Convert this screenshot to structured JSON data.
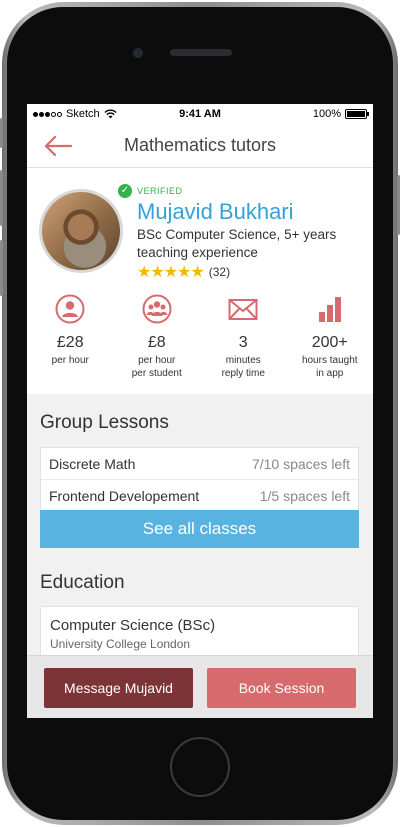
{
  "status_bar": {
    "carrier": "Sketch",
    "time": "9:41 AM",
    "battery": "100%"
  },
  "nav": {
    "title": "Mathematics tutors",
    "back_icon": "arrow-left-icon"
  },
  "tutor": {
    "verified_label": "VERIFIED",
    "name": "Mujavid Bukhari",
    "description": "BSc Computer Science, 5+ years teaching experience",
    "stars": "★★★★★",
    "rating_value": 5,
    "review_count": "(32)"
  },
  "stats": [
    {
      "icon": "user-icon",
      "value": "£28",
      "label_line1": "per hour",
      "label_line2": ""
    },
    {
      "icon": "group-icon",
      "value": "£8",
      "label_line1": "per hour",
      "label_line2": "per student"
    },
    {
      "icon": "envelope-icon",
      "value": "3",
      "label_line1": "minutes",
      "label_line2": "reply time"
    },
    {
      "icon": "bar-chart-icon",
      "value": "200+",
      "label_line1": "hours taught",
      "label_line2": "in app"
    }
  ],
  "group_lessons": {
    "title": "Group Lessons",
    "items": [
      {
        "name": "Discrete Math",
        "spaces": "7/10 spaces left"
      },
      {
        "name": "Frontend Developement",
        "spaces": "1/5 spaces left"
      }
    ],
    "see_all_label": "See all classes"
  },
  "education": {
    "title": "Education",
    "degree": "Computer Science (BSc)",
    "school": "University College London"
  },
  "actions": {
    "message_label": "Message Mujavid",
    "book_label": "Book Session"
  },
  "colors": {
    "accent_red": "#d66a6c",
    "dark_red": "#7c3436",
    "link_blue": "#37a0d9",
    "button_blue": "#59b3e0",
    "verified_green": "#35b24a",
    "star_gold": "#f5b800"
  }
}
